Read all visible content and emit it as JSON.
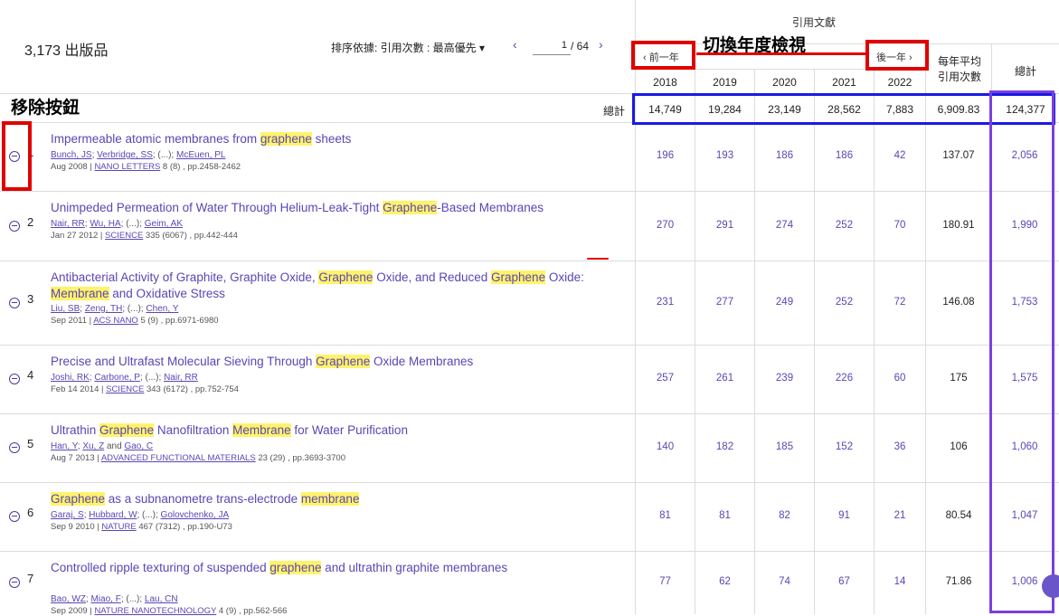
{
  "header": {
    "count": "3,173 出版品",
    "sort": "排序依據: 引用次數 : 最高優先",
    "sort_arrow": "▾",
    "page_current": "1",
    "page_total": "/ 64",
    "prev_arrow": "‹",
    "next_arrow": "›"
  },
  "cited_header": {
    "title": "引用文獻",
    "prev_year": "‹ 前一年",
    "next_year": "後一年 ›",
    "years": [
      "2018",
      "2019",
      "2020",
      "2021",
      "2022"
    ],
    "avg_label_1": "每年平均",
    "avg_label_2": "引用次數",
    "total_label": "總計"
  },
  "totals": {
    "label": "總計",
    "years": [
      "14,749",
      "19,284",
      "23,149",
      "28,562",
      "7,883"
    ],
    "avg": "6,909.83",
    "total": "124,377"
  },
  "annotations": {
    "switch_year": "切換年度檢視",
    "remove_button": "移除按鈕"
  },
  "rows": [
    {
      "num": "1",
      "title_parts": [
        [
          "Impermeable atomic membranes from ",
          false
        ],
        [
          "graphene",
          true
        ],
        [
          " sheets",
          false
        ]
      ],
      "authors": [
        [
          "Bunch, JS",
          true
        ],
        [
          "; ",
          false
        ],
        [
          "Verbridge, SS",
          true
        ],
        [
          "; (...); ",
          false
        ],
        [
          "McEuen, PL",
          true
        ]
      ],
      "date": "Aug 2008 | ",
      "journal": "NANO LETTERS",
      "pages": " 8 (8) , pp.2458-2462",
      "years": [
        "196",
        "193",
        "186",
        "186",
        "42"
      ],
      "avg": "137.07",
      "total": "2,056"
    },
    {
      "num": "2",
      "title_parts": [
        [
          "Unimpeded Permeation of Water Through Helium-Leak-Tight ",
          false
        ],
        [
          "Graphene",
          true
        ],
        [
          "-Based Membranes",
          false
        ]
      ],
      "authors": [
        [
          "Nair, RR",
          true
        ],
        [
          "; ",
          false
        ],
        [
          "Wu, HA",
          true
        ],
        [
          "; (...); ",
          false
        ],
        [
          "Geim, AK",
          true
        ]
      ],
      "date": "Jan 27 2012 | ",
      "journal": "SCIENCE",
      "pages": " 335 (6067) , pp.442-444",
      "years": [
        "270",
        "291",
        "274",
        "252",
        "70"
      ],
      "avg": "180.91",
      "total": "1,990"
    },
    {
      "num": "3",
      "title_parts": [
        [
          "Antibacterial Activity of Graphite, Graphite Oxide, ",
          false
        ],
        [
          "Graphene",
          true
        ],
        [
          " Oxide, and Reduced ",
          false
        ],
        [
          "Graphene",
          true
        ],
        [
          " Oxide: ",
          false
        ],
        [
          "Membrane",
          true
        ],
        [
          " and Oxidative Stress",
          false
        ]
      ],
      "authors": [
        [
          "Liu, SB",
          true
        ],
        [
          "; ",
          false
        ],
        [
          "Zeng, TH",
          true
        ],
        [
          "; (...); ",
          false
        ],
        [
          "Chen, Y",
          true
        ]
      ],
      "date": "Sep 2011 | ",
      "journal": "ACS NANO",
      "pages": " 5 (9) , pp.6971-6980",
      "years": [
        "231",
        "277",
        "249",
        "252",
        "72"
      ],
      "avg": "146.08",
      "total": "1,753"
    },
    {
      "num": "4",
      "title_parts": [
        [
          "Precise and Ultrafast Molecular Sieving Through ",
          false
        ],
        [
          "Graphene",
          true
        ],
        [
          " Oxide Membranes",
          false
        ]
      ],
      "authors": [
        [
          "Joshi, RK",
          true
        ],
        [
          "; ",
          false
        ],
        [
          "Carbone, P",
          true
        ],
        [
          "; (...); ",
          false
        ],
        [
          "Nair, RR",
          true
        ]
      ],
      "date": "Feb 14 2014 | ",
      "journal": "SCIENCE",
      "pages": " 343 (6172) , pp.752-754",
      "years": [
        "257",
        "261",
        "239",
        "226",
        "60"
      ],
      "avg": "175",
      "total": "1,575"
    },
    {
      "num": "5",
      "title_parts": [
        [
          "Ultrathin ",
          false
        ],
        [
          "Graphene",
          true
        ],
        [
          " Nanofiltration ",
          false
        ],
        [
          "Membrane",
          true
        ],
        [
          " for Water Purification",
          false
        ]
      ],
      "authors": [
        [
          "Han, Y",
          true
        ],
        [
          "; ",
          false
        ],
        [
          "Xu, Z",
          true
        ],
        [
          " and ",
          false
        ],
        [
          "Gao, C",
          true
        ]
      ],
      "date": "Aug 7 2013 | ",
      "journal": "ADVANCED FUNCTIONAL MATERIALS",
      "pages": " 23 (29) , pp.3693-3700",
      "years": [
        "140",
        "182",
        "185",
        "152",
        "36"
      ],
      "avg": "106",
      "total": "1,060"
    },
    {
      "num": "6",
      "title_parts": [
        [
          "Graphene",
          true
        ],
        [
          " as a subnanometre trans-electrode ",
          false
        ],
        [
          "membrane",
          true
        ]
      ],
      "authors": [
        [
          "Garaj, S",
          true
        ],
        [
          "; ",
          false
        ],
        [
          "Hubbard, W",
          true
        ],
        [
          "; (...); ",
          false
        ],
        [
          "Golovchenko, JA",
          true
        ]
      ],
      "date": "Sep 9 2010 | ",
      "journal": "NATURE",
      "pages": " 467 (7312) , pp.190-U73",
      "years": [
        "81",
        "81",
        "82",
        "91",
        "21"
      ],
      "avg": "80.54",
      "total": "1,047"
    },
    {
      "num": "7",
      "title_parts": [
        [
          "Controlled ripple texturing of suspended ",
          false
        ],
        [
          "graphene",
          true
        ],
        [
          " and ultrathin graphite membranes",
          false
        ]
      ],
      "authors": [
        [
          "Bao, WZ",
          true
        ],
        [
          "; ",
          false
        ],
        [
          "Miao, F",
          true
        ],
        [
          "; (...); ",
          false
        ],
        [
          "Lau, CN",
          true
        ]
      ],
      "date": "Sep 2009 | ",
      "journal": "NATURE NANOTECHNOLOGY",
      "pages": " 4 (9) , pp.562-566",
      "years": [
        "77",
        "62",
        "74",
        "67",
        "14"
      ],
      "avg": "71.86",
      "total": "1,006"
    }
  ]
}
